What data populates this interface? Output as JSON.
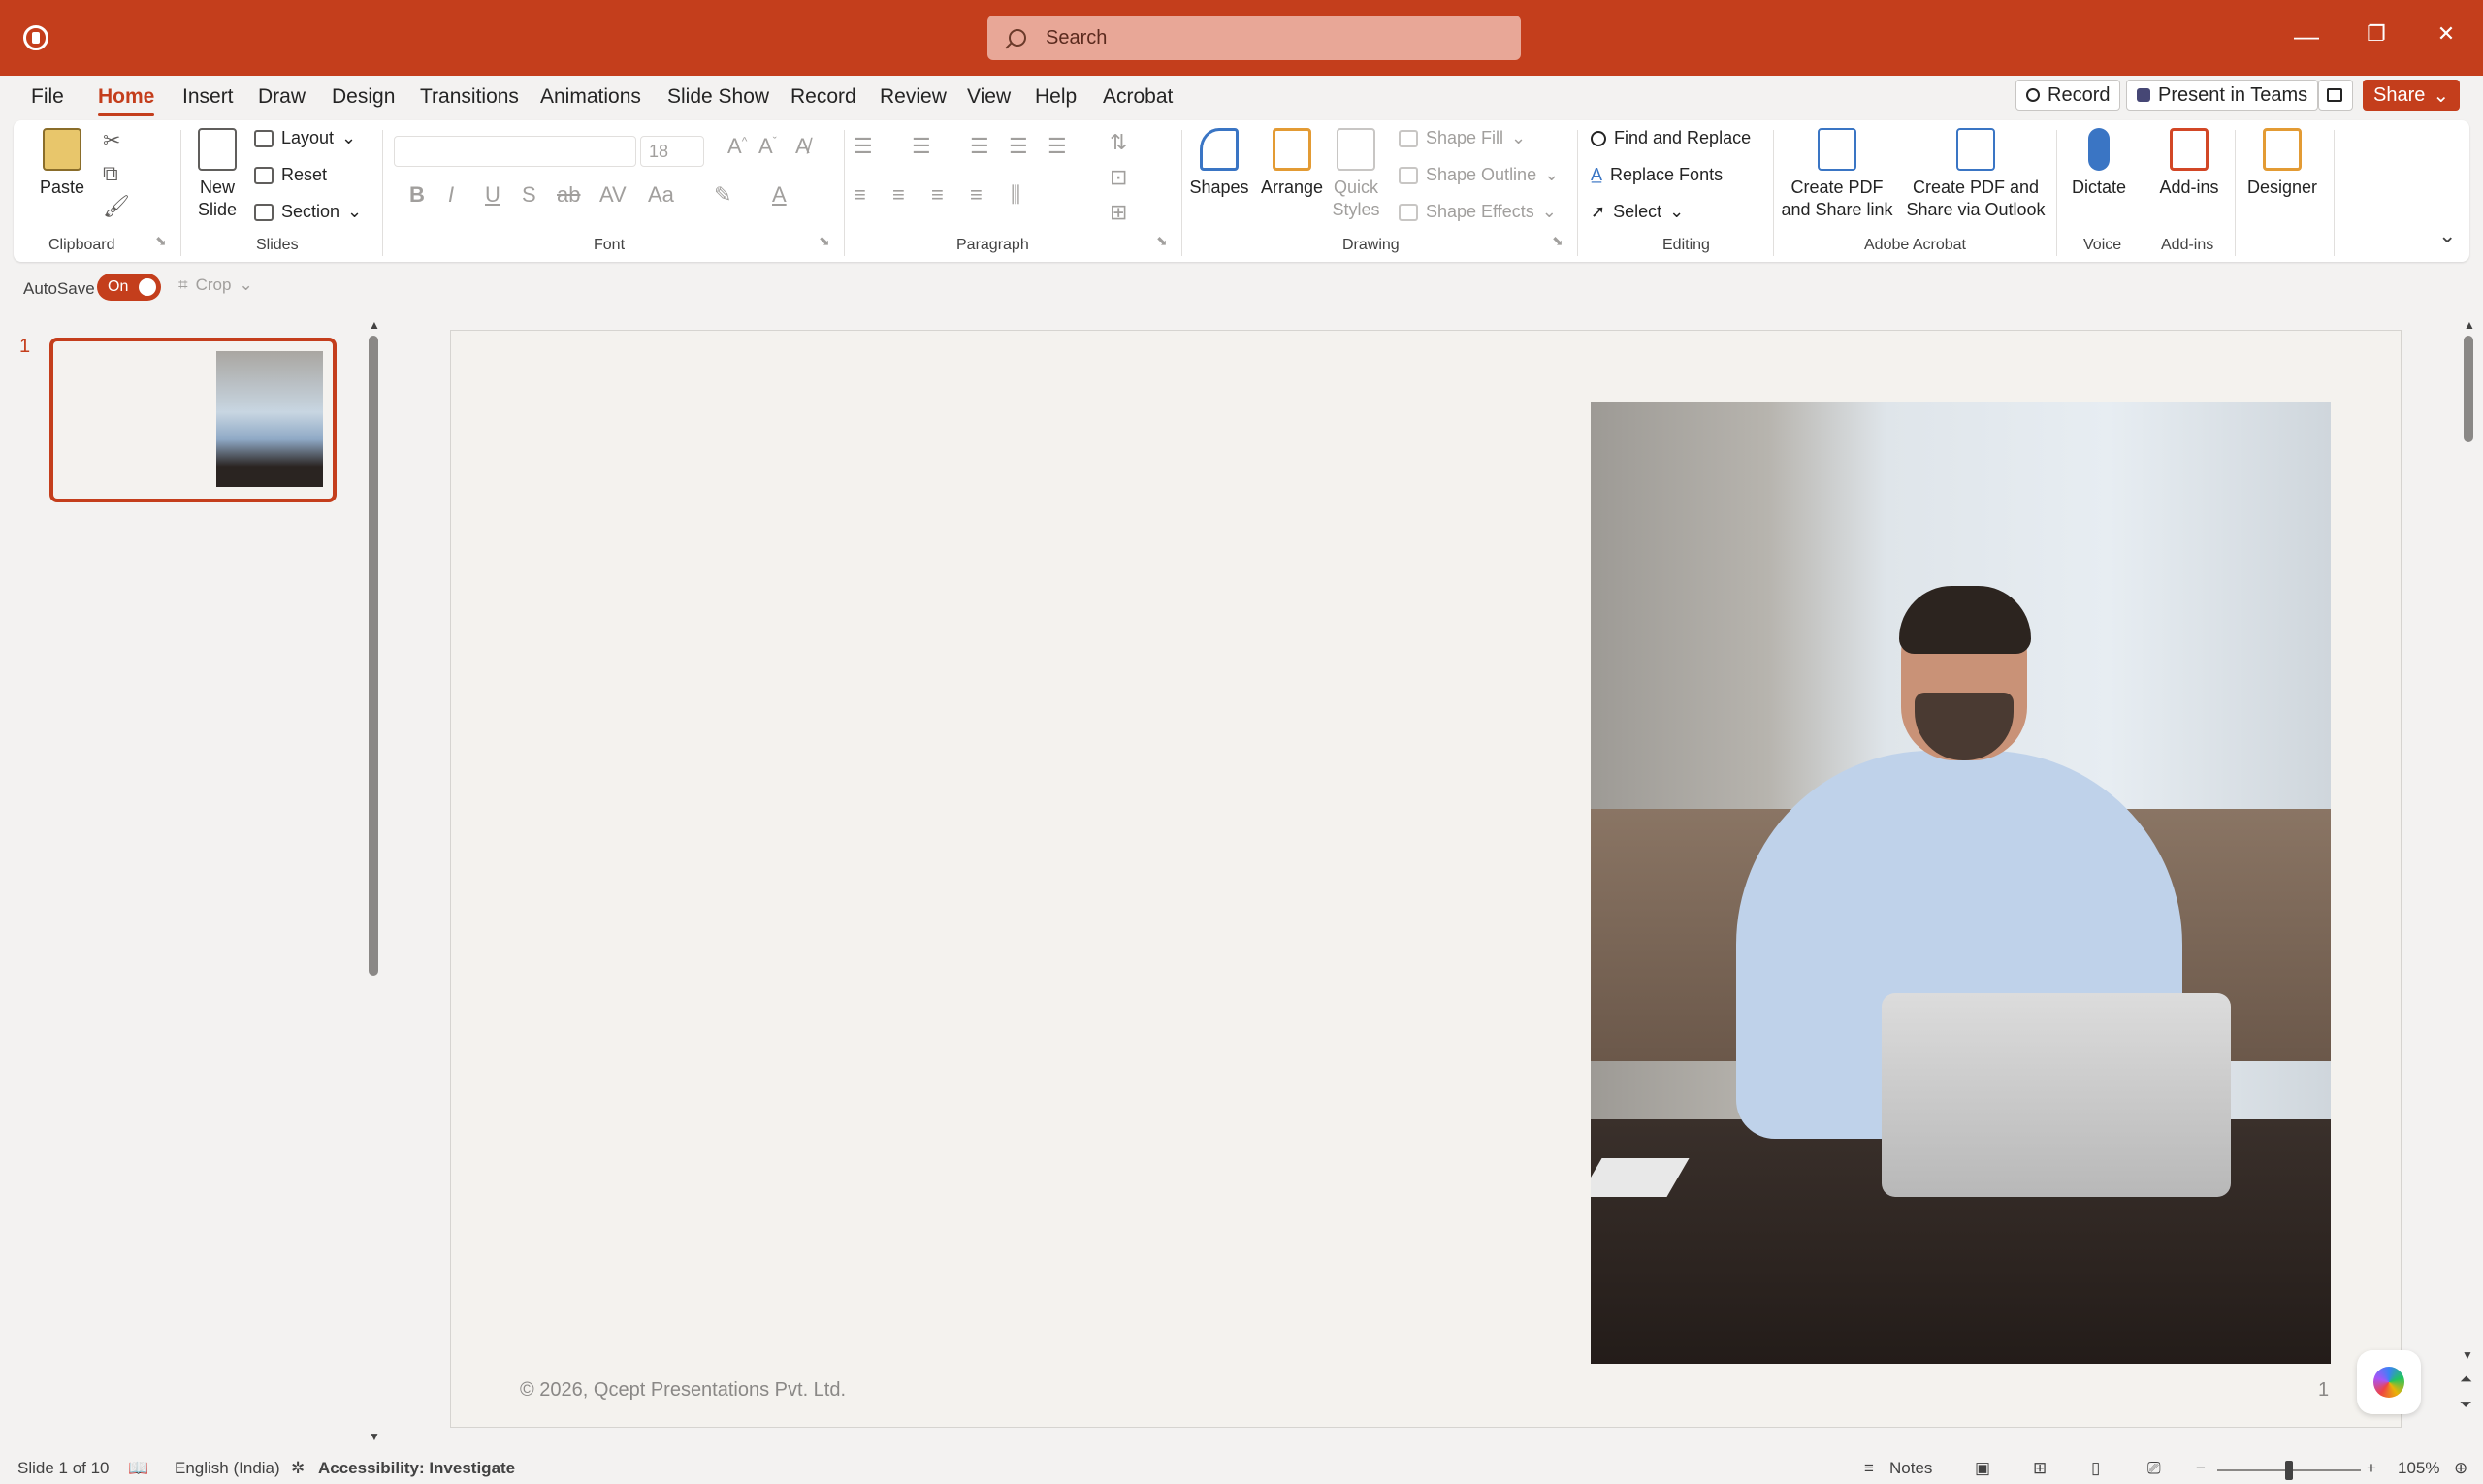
{
  "titlebar": {
    "search_placeholder": "Search",
    "minimize": "—",
    "restore": "❐",
    "close": "✕"
  },
  "menu": {
    "tabs": [
      "File",
      "Home",
      "Insert",
      "Draw",
      "Design",
      "Transitions",
      "Animations",
      "Slide Show",
      "Record",
      "Review",
      "View",
      "Help",
      "Acrobat"
    ],
    "active": "Home",
    "record_label": "Record",
    "present_label": "Present in Teams",
    "share_label": "Share"
  },
  "ribbon": {
    "clipboard": {
      "paste": "Paste",
      "group": "Clipboard"
    },
    "slides": {
      "new_slide_1": "New",
      "new_slide_2": "Slide",
      "layout": "Layout",
      "reset": "Reset",
      "section": "Section",
      "group": "Slides"
    },
    "font": {
      "size": "18",
      "group": "Font"
    },
    "paragraph": {
      "group": "Paragraph"
    },
    "drawing": {
      "shapes": "Shapes",
      "arrange": "Arrange",
      "quick_styles_1": "Quick",
      "quick_styles_2": "Styles",
      "shape_fill": "Shape Fill",
      "shape_outline": "Shape Outline",
      "shape_effects": "Shape Effects",
      "group": "Drawing"
    },
    "editing": {
      "find_replace": "Find and Replace",
      "replace_fonts": "Replace Fonts",
      "select": "Select",
      "group": "Editing"
    },
    "acrobat": {
      "create_pdf_1": "Create PDF",
      "create_pdf_2": "and Share link",
      "share_outlook_1": "Create PDF and",
      "share_outlook_2": "Share via Outlook",
      "group": "Adobe Acrobat"
    },
    "voice": {
      "dictate": "Dictate",
      "group": "Voice"
    },
    "addins": {
      "addins": "Add-ins",
      "group": "Add-ins"
    },
    "designer": {
      "designer": "Designer"
    }
  },
  "quick_access": {
    "autosave": "AutoSave",
    "toggle": "On",
    "crop": "Crop"
  },
  "thumbnails": {
    "number": "1"
  },
  "slide": {
    "footer": "© 2026, Qcept Presentations Pvt. Ltd.",
    "page_number": "1"
  },
  "status": {
    "slide_of": "Slide 1 of 10",
    "language": "English (India)",
    "accessibility": "Accessibility: Investigate",
    "notes": "Notes",
    "zoom": "105%"
  }
}
